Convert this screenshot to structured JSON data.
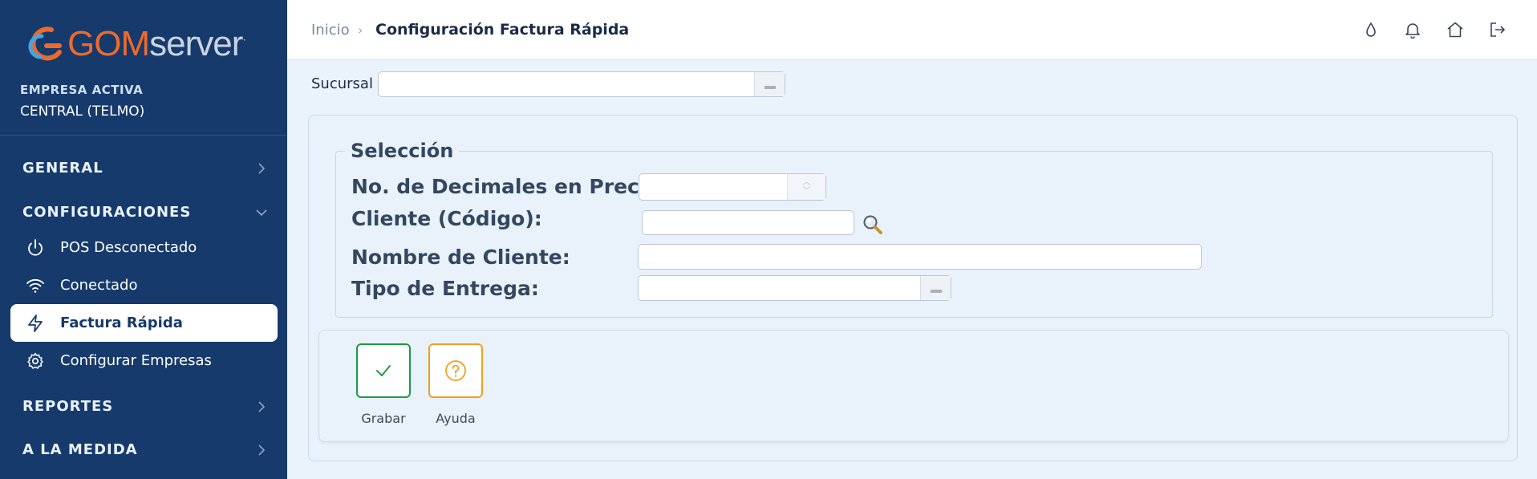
{
  "brand": {
    "gom": "GOM",
    "server": "server",
    "mark": "·"
  },
  "company": {
    "label": "EMPRESA ACTIVA",
    "name": "CENTRAL (TELMO)"
  },
  "sidebar": {
    "sections": [
      {
        "label": "GENERAL",
        "expanded": false
      },
      {
        "label": "CONFIGURACIONES",
        "expanded": true
      },
      {
        "label": "REPORTES",
        "expanded": false
      },
      {
        "label": "A LA MEDIDA",
        "expanded": false
      }
    ],
    "items": [
      {
        "label": "POS Desconectado",
        "icon": "power-icon"
      },
      {
        "label": "Conectado",
        "icon": "wifi-icon"
      },
      {
        "label": "Factura Rápida",
        "icon": "lightning-icon",
        "active": true
      },
      {
        "label": "Configurar Empresas",
        "icon": "gear-icon"
      }
    ]
  },
  "breadcrumb": {
    "home": "Inicio",
    "separator": "›",
    "current": "Configuración Factura Rápida"
  },
  "topbar": {
    "icons": [
      "drop-icon",
      "bell-icon",
      "home-icon",
      "logout-icon"
    ]
  },
  "filter": {
    "sucursal_label": "Sucursal",
    "sucursal_value": ""
  },
  "form": {
    "legend": "Selección",
    "decimals_label": "No. de Decimales en Precio:",
    "decimals_value": "",
    "client_code_label": "Cliente (Código):",
    "client_code_value": "",
    "client_name_label": "Nombre de Cliente:",
    "client_name_value": "",
    "delivery_label": "Tipo de Entrega:",
    "delivery_value": ""
  },
  "actions": {
    "save_label": "Grabar",
    "help_label": "Ayuda"
  },
  "colors": {
    "sidebar": "#163a6c",
    "accent_orange": "#ee6a2b",
    "save_green": "#1f9a47",
    "help_orange": "#f0a01e",
    "content_bg": "#eaf2fb"
  }
}
